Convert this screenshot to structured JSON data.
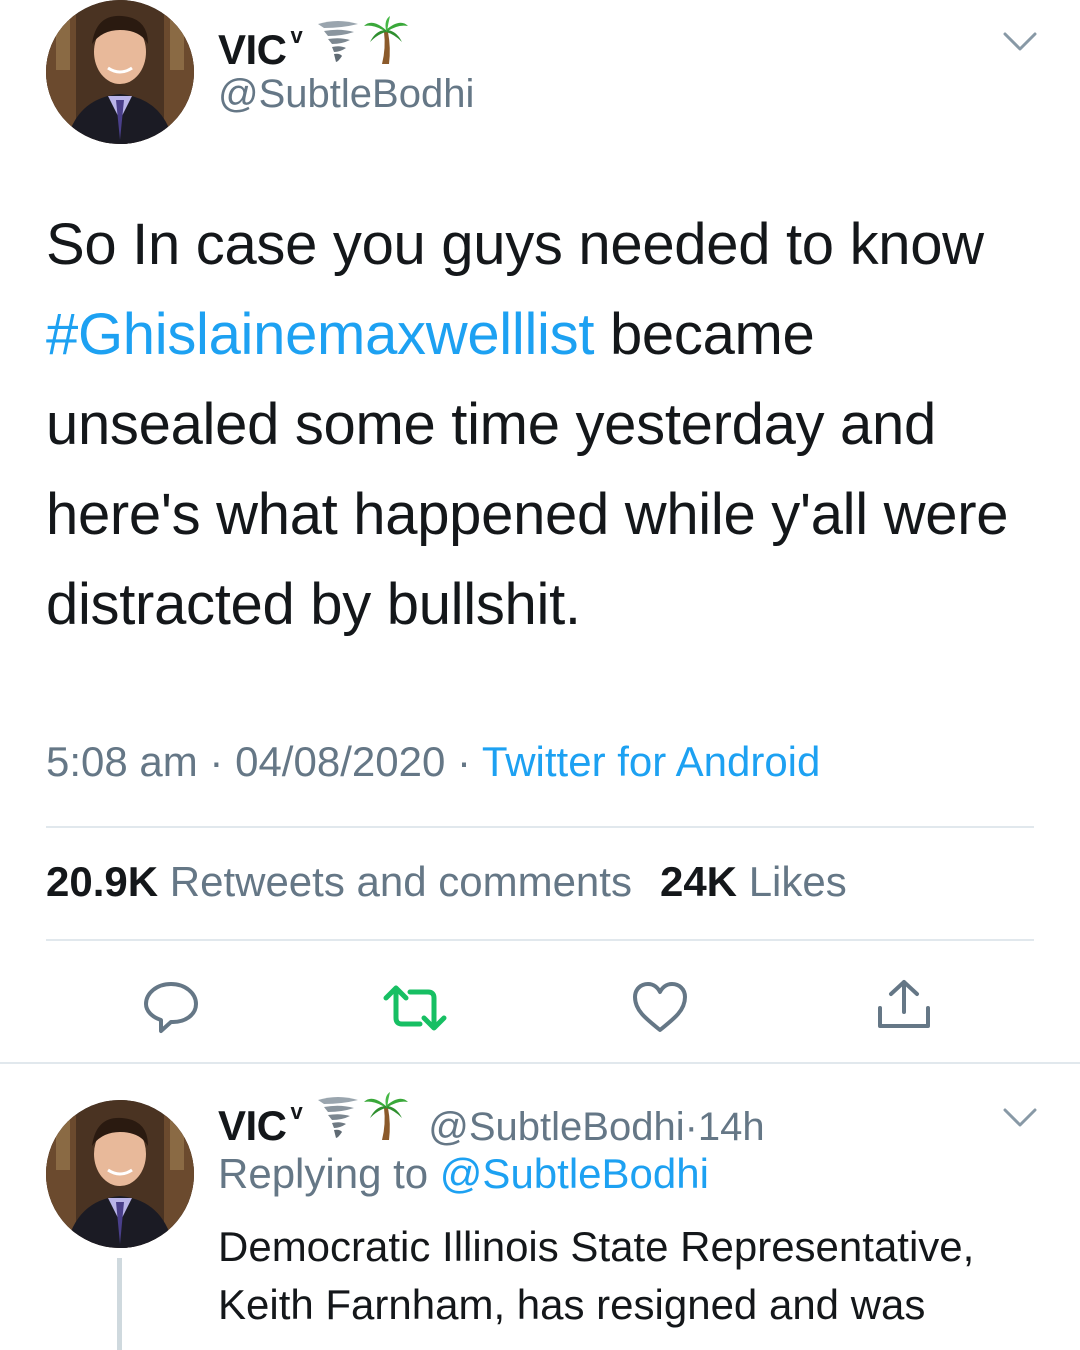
{
  "tweet": {
    "author_name": "VIC",
    "author_superscript": "v",
    "author_handle": "@SubtleBodhi",
    "emoji_names": [
      "tornado-emoji",
      "palm-tree-emoji"
    ],
    "text_part1": "So In case you guys needed to know",
    "hashtag": "#Ghislainemaxwelllist",
    "text_part2": " became unsealed some time yesterday and here's what happened while y'all were distracted by bullshit.",
    "time": "5:08 am",
    "date": "04/08/2020",
    "source": "Twitter for Android",
    "separator": " · ",
    "retweets_count": "20.9K",
    "retweets_label": "Retweets and comments",
    "likes_count": "24K",
    "likes_label": "Likes"
  },
  "actions": [
    "reply-icon",
    "retweet-icon",
    "like-icon",
    "share-icon"
  ],
  "reply": {
    "author_name": "VIC",
    "author_superscript": "v",
    "author_handle": "@SubtleBodhi",
    "time_sep": " · ",
    "time_ago": "14h",
    "replying_label": "Replying to ",
    "replying_handle": "@SubtleBodhi",
    "text": "Democratic Illinois State Representative, Keith Farnham, has resigned and was"
  },
  "colors": {
    "accent": "#1da1f2",
    "retweet_green": "#17bf63",
    "muted": "#657786",
    "divider": "#e1e8ed"
  }
}
